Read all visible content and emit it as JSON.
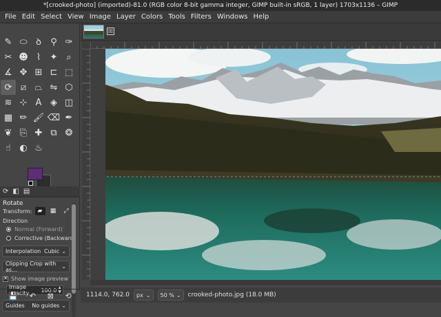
{
  "window": {
    "title": "*[crooked-photo] (imported)-81.0 (RGB color 8-bit gamma integer, GIMP built-in sRGB, 1 layer) 1703x1136 – GIMP"
  },
  "menu": [
    "File",
    "Edit",
    "Select",
    "View",
    "Image",
    "Layer",
    "Colors",
    "Tools",
    "Filters",
    "Windows",
    "Help"
  ],
  "toolbox": {
    "tools": [
      {
        "name": "airbrush-icon",
        "glyph": "✎"
      },
      {
        "name": "ellipse-select-icon",
        "glyph": "⬭"
      },
      {
        "name": "lasso-icon",
        "glyph": "ꝺ"
      },
      {
        "name": "fuzzy-select-icon",
        "glyph": "⚲"
      },
      {
        "name": "color-picker-icon",
        "glyph": "✑"
      },
      {
        "name": "scissors-icon",
        "glyph": "✂"
      },
      {
        "name": "foreground-select-icon",
        "glyph": "☻"
      },
      {
        "name": "path-icon",
        "glyph": "⌇"
      },
      {
        "name": "paths-icon",
        "glyph": "✦"
      },
      {
        "name": "zoom-icon",
        "glyph": "⌕"
      },
      {
        "name": "measure-icon",
        "glyph": "∡"
      },
      {
        "name": "move-icon",
        "glyph": "✥"
      },
      {
        "name": "align-icon",
        "glyph": "⊞"
      },
      {
        "name": "crop-icon",
        "glyph": "⊏"
      },
      {
        "name": "unified-transform-icon",
        "glyph": "⬚"
      },
      {
        "name": "rotate-icon",
        "glyph": "⟳"
      },
      {
        "name": "shear-icon",
        "glyph": "⧄"
      },
      {
        "name": "perspective-icon",
        "glyph": "⏢"
      },
      {
        "name": "flip-icon",
        "glyph": "⇋"
      },
      {
        "name": "cage-icon",
        "glyph": "⬡"
      },
      {
        "name": "warp-icon",
        "glyph": "≋"
      },
      {
        "name": "handle-transform-icon",
        "glyph": "⊹"
      },
      {
        "name": "text-icon",
        "glyph": "A"
      },
      {
        "name": "bucket-fill-icon",
        "glyph": "◈"
      },
      {
        "name": "3d-transform-icon",
        "glyph": "◫"
      },
      {
        "name": "gradient-icon",
        "glyph": "▦"
      },
      {
        "name": "pencil-icon",
        "glyph": "✏"
      },
      {
        "name": "paintbrush-icon",
        "glyph": "🖌"
      },
      {
        "name": "eraser-icon",
        "glyph": "⌫"
      },
      {
        "name": "ink-icon",
        "glyph": "✒"
      },
      {
        "name": "mypaint-brush-icon",
        "glyph": "❦"
      },
      {
        "name": "clone-icon",
        "glyph": "⎘"
      },
      {
        "name": "heal-icon",
        "glyph": "✚"
      },
      {
        "name": "perspective-clone-icon",
        "glyph": "⧉"
      },
      {
        "name": "blur-icon",
        "glyph": "❂"
      },
      {
        "name": "smudge-icon",
        "glyph": "☝"
      },
      {
        "name": "dodge-burn-icon",
        "glyph": "◐"
      },
      {
        "name": "color-balance-icon",
        "glyph": "♨"
      }
    ],
    "active_tool_index": 15,
    "tab_icons": [
      "⟳",
      "◧",
      "▤"
    ]
  },
  "tool_options": {
    "title": "Rotate",
    "transform_label": "Transform:",
    "transform_icons": [
      "▰",
      "▦",
      "⤢"
    ],
    "direction_label": "Direction",
    "direction_options": [
      {
        "label": "Normal (Forward)",
        "selected": true
      },
      {
        "label": "Corrective (Backward)",
        "selected": false
      }
    ],
    "interpolation_label": "Interpolation",
    "interpolation_value": "Cubic",
    "clipping_value": "Clipping Crop with as...",
    "show_preview_label": "Show image preview",
    "show_preview_checked": true,
    "image_opacity_label": "Image opacity",
    "image_opacity_value": "100.0",
    "guides_label": "Guides",
    "guides_value": "No guides"
  },
  "bottom_actions": [
    "💾",
    "↶",
    "⊠",
    "⟲"
  ],
  "image_window": {
    "tab_close": "☒",
    "status": {
      "coords": "1114.0, 762.0",
      "unit": "px",
      "zoom": "50 %",
      "file_info": "crooked-photo.jpg (18.0 MB)"
    }
  }
}
